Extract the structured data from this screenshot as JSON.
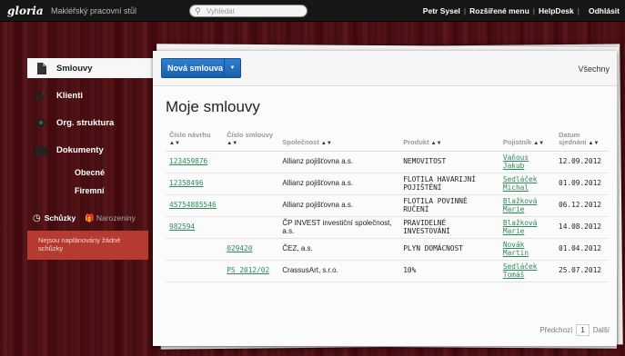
{
  "topbar": {
    "logo": "gloria",
    "app_title": "Makléřský pracovní stůl",
    "search_placeholder": "Vyhledat",
    "nav": [
      "Petr Sysel",
      "Rozšířené menu",
      "HelpDesk",
      "Odhlásit"
    ]
  },
  "sidebar": {
    "items": [
      {
        "label": "Smlouvy",
        "icon": "document-icon"
      },
      {
        "label": "Klienti",
        "icon": "users-icon"
      },
      {
        "label": "Org. struktura",
        "icon": "org-structure-icon"
      },
      {
        "label": "Dokumenty",
        "icon": "documents-icon"
      }
    ],
    "subitems": [
      "Obecné",
      "Firemní"
    ],
    "meetings_label": "Schůzky",
    "birthdays_label": "Narozeniny",
    "notice": "Nejsou naplánovány žádné schůzky"
  },
  "main": {
    "new_button": "Nová smlouva",
    "filter_label": "Všechny",
    "title": "Moje smlouvy",
    "columns": [
      "Číslo návrhu",
      "Číslo smlouvy",
      "Společnost",
      "Produkt",
      "Pojistník",
      "Datum sjednání"
    ],
    "rows": [
      {
        "proposal": "123459876",
        "contract": "",
        "company": "Allianz pojišťovna a.s.",
        "product": "NEMOVITOST",
        "holder": "Vaňous Jakub",
        "date": "12.09.2012"
      },
      {
        "proposal": "12358496",
        "contract": "",
        "company": "Allianz pojišťovna a.s.",
        "product": "FLOTILA HAVARIJNÍ POJIŠTĚNÍ",
        "holder": "Sedláček Michal",
        "date": "01.09.2012"
      },
      {
        "proposal": "45754885546",
        "contract": "",
        "company": "Allianz pojišťovna a.s.",
        "product": "FLOTILA POVINNÉ RUČENÍ",
        "holder": "Blažková Marie",
        "date": "06.12.2012"
      },
      {
        "proposal": "982594",
        "contract": "",
        "company": "ČP INVEST investiční společnost, a.s.",
        "product": "PRAVIDELNÉ INVESTOVÁNÍ",
        "holder": "Blažková Marie",
        "date": "14.08.2012"
      },
      {
        "proposal": "",
        "contract": "029420",
        "company": "ČEZ, a.s.",
        "product": "PLYN DOMÁCNOST",
        "holder": "Novák Martin",
        "date": "01.04.2012"
      },
      {
        "proposal": "",
        "contract": "PS 2012/02",
        "company": "CrassusArt, s.r.o.",
        "product": "10%",
        "holder": "Sedláček Tomáš",
        "date": "25.07.2012"
      }
    ],
    "pager": {
      "prev": "Předchozí",
      "page": "1",
      "next": "Další"
    }
  },
  "colors": {
    "accent": "#1f66b3",
    "link": "#2e8b57",
    "notice": "#b53a30",
    "topbar": "#161616"
  }
}
